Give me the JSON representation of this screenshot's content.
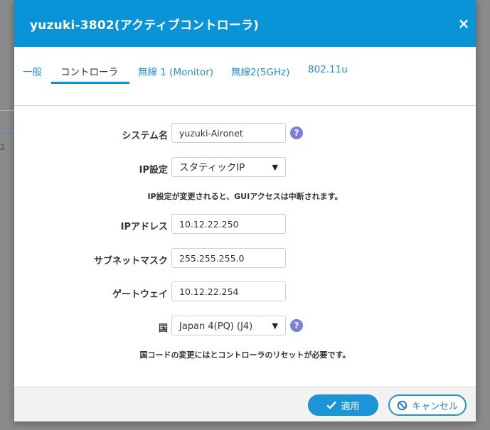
{
  "backdrop": {
    "row_number": "2"
  },
  "dialog": {
    "title": "yuzuki-3802(アクティブコントローラ)",
    "close_symbol": "×"
  },
  "tabs": [
    {
      "label": "一般"
    },
    {
      "label": "コントローラ",
      "active": true
    },
    {
      "label": "無線 1 (Monitor)"
    },
    {
      "label": "無線2(5GHz)"
    },
    {
      "label": "802.11u"
    }
  ],
  "form": {
    "system_name": {
      "label": "システム名",
      "value": "yuzuki-Aironet"
    },
    "ip_setting": {
      "label": "IP設定",
      "value": "スタティックIP",
      "note": "IP設定が変更されると、GUIアクセスは中断されます。"
    },
    "ip_address": {
      "label": "IPアドレス",
      "value": "10.12.22.250"
    },
    "subnet_mask": {
      "label": "サブネットマスク",
      "value": "255.255.255.0"
    },
    "gateway": {
      "label": "ゲートウェイ",
      "value": "10.12.22.254"
    },
    "country": {
      "label": "国",
      "value": "Japan 4(PQ) (J4)",
      "note": "国コードの変更にはとコントローラのリセットが必要です。"
    },
    "help_symbol": "?"
  },
  "footer": {
    "apply_label": "適用",
    "cancel_label": "キャンセル"
  },
  "colors": {
    "header": "#0a93d6",
    "accent": "#1a95d8",
    "help": "#7a7fd9"
  }
}
